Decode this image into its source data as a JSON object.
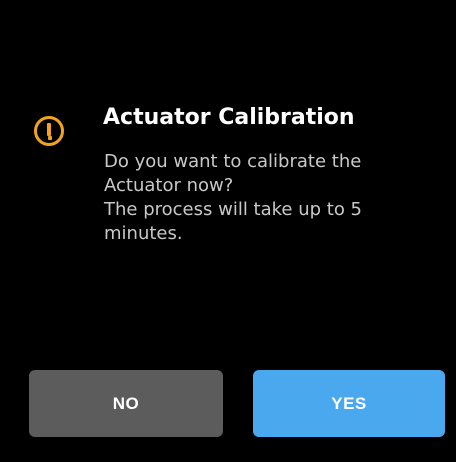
{
  "dialog": {
    "title": "Actuator Calibration",
    "message_lines": [
      "Do you want to calibrate the",
      "Actuator now?",
      "The process will take up to 5",
      "minutes."
    ],
    "icon": "warning-exclamation-icon"
  },
  "buttons": {
    "no_label": "NO",
    "yes_label": "YES"
  },
  "colors": {
    "background": "#000000",
    "warning": "#F2A51A",
    "no_button": "#5C5C5C",
    "yes_button": "#4AA8EE",
    "title_text": "#FFFFFF",
    "message_text": "#C8C8C8"
  }
}
